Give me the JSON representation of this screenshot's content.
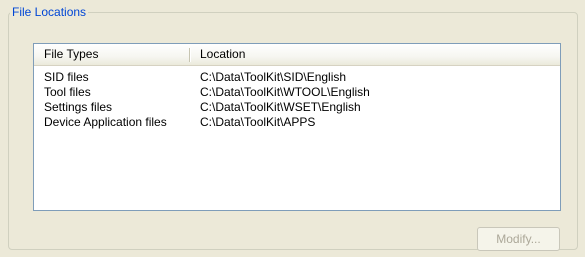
{
  "groupbox": {
    "title": "File Locations"
  },
  "listview": {
    "columns": {
      "file_types": "File Types",
      "location": "Location"
    },
    "rows": [
      {
        "type": "SID files",
        "location": "C:\\Data\\ToolKit\\SID\\English"
      },
      {
        "type": "Tool files",
        "location": "C:\\Data\\ToolKit\\WTOOL\\English"
      },
      {
        "type": "Settings files",
        "location": "C:\\Data\\ToolKit\\WSET\\English"
      },
      {
        "type": "Device Application files",
        "location": "C:\\Data\\ToolKit\\APPS"
      }
    ]
  },
  "buttons": {
    "modify_label": "Modify...",
    "modify_enabled": false
  },
  "colors": {
    "dialog_background": "#ece9d8",
    "groupbox_title": "#0046d5",
    "list_border": "#7f9db9",
    "disabled_text": "#aca899"
  }
}
